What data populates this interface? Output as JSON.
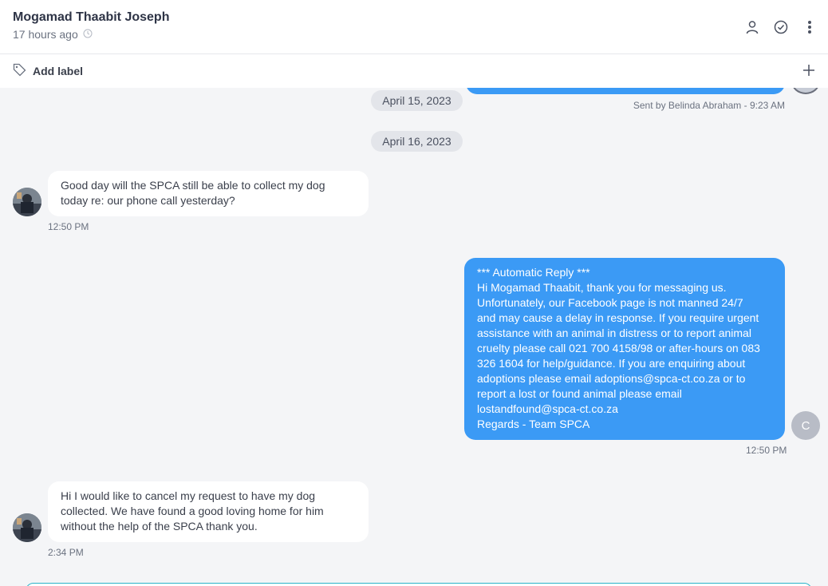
{
  "header": {
    "contact_name": "Mogamad Thaabit Joseph",
    "last_seen": "17 hours ago",
    "icons": [
      "person-icon",
      "check-circle-icon",
      "more-vertical-icon"
    ]
  },
  "label_bar": {
    "add_label": "Add label"
  },
  "conversation": {
    "sent_by": "Sent by Belinda Abraham - 9:23 AM",
    "dates": [
      "April 15, 2023",
      "April 16, 2023"
    ],
    "messages": [
      {
        "direction": "incoming",
        "text": "Good day will the SPCA still be able to collect my dog\ntoday re: our phone call yesterday?",
        "time": "12:50 PM"
      },
      {
        "direction": "outgoing",
        "text": "*** Automatic Reply ***\nHi Mogamad Thaabit, thank you for messaging us.\nUnfortunately, our Facebook page is not manned 24/7\nand may cause a delay in response. If you require urgent\nassistance with an animal in distress or to report animal\ncruelty please call 021 700 4158/98 or after-hours on 083\n326 1604 for help/guidance. If you are enquiring about\nadoptions please email adoptions@spca-ct.co.za or to\nreport a lost or found animal please email\nlostandfound@spca-ct.co.za\nRegards - Team SPCA",
        "time": "12:50 PM",
        "agent_initial": "C"
      },
      {
        "direction": "incoming",
        "text": "Hi I would like to cancel my request to have my dog\ncollected. We have found a good loving home for him\nwithout the help of the SPCA thank you.",
        "time": "2:34 PM"
      }
    ]
  },
  "colors": {
    "outgoing_bubble": "#3b9af5",
    "incoming_bubble": "#ffffff",
    "background": "#f4f5f7",
    "composer_border": "#2bb3c9"
  }
}
